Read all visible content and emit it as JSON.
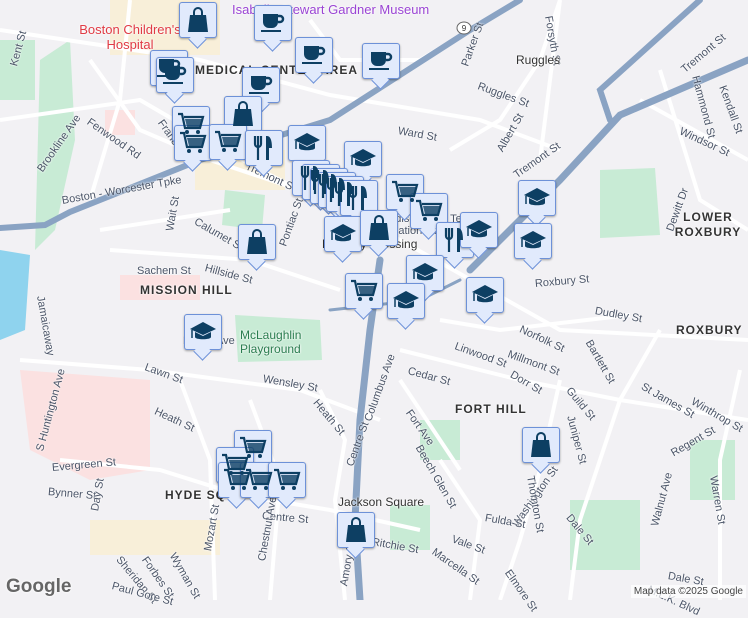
{
  "map": {
    "labels": [
      "Kent St",
      "Brookline Ave",
      "Fenwood Rd",
      "Boston - Worcester Tpke",
      "Wait St",
      "Calumet St",
      "Pontiac St",
      "Sachem St",
      "Hillside St",
      "Jamaicaway",
      "Parker St",
      "Ruggles St",
      "Forsyth St",
      "Ward St",
      "Albert St",
      "Tremont St",
      "Tremont St",
      "Hammond St",
      "Kendall St",
      "Windsor St",
      "Dewitt Dr",
      "Roxbury St",
      "Dudley St",
      "Norfolk St",
      "Bartlett St",
      "Millmont St",
      "Linwood St",
      "Dorr St",
      "Cedar St",
      "Columbus Ave",
      "Heath St",
      "Wensley St",
      "Lawn St",
      "Heath St",
      "Fisher Ave",
      "S Huntington Ave",
      "Evergreen St",
      "Bynner St",
      "Day St",
      "Centre St",
      "Centre St",
      "Fort Ave",
      "Beech Glen St",
      "Guild St",
      "St James St",
      "Juniper St",
      "Regent St",
      "Washington St",
      "Thornton St",
      "Dale St",
      "Walnut Ave",
      "Warren St",
      "Fulda St",
      "Vale St",
      "Marcella St",
      "Ritchie St",
      "Amory St",
      "Chestnut Ave",
      "Mozart St",
      "Wyman St",
      "Forbes St",
      "Sheridan St",
      "Paul Gore St",
      "M.L.K. Blvd",
      "Elmore St",
      "Dale St",
      "Tremont St",
      "Francis St",
      "Winthrop St"
    ],
    "areas": [
      "MISSION HILL",
      "LOWER ROXBURY",
      "ROXBURY",
      "FORT HILL",
      "HYDE SQ",
      "MEDICAL CENTER AREA"
    ],
    "pois": {
      "hospital": "Boston Children's Hospital",
      "museum": "Isabella Stewart Gardner Museum",
      "school": "Madison Park Technical Vocational High School",
      "park": "McLaughlin Playground"
    },
    "stations": [
      "Ruggles",
      "Roxbury Crossing",
      "Jackson Square"
    ],
    "route_shield": "9"
  },
  "markers": [
    {
      "type": "shopping-bag"
    },
    {
      "type": "coffee"
    },
    {
      "type": "coffee"
    },
    {
      "type": "coffee"
    },
    {
      "type": "coffee"
    },
    {
      "type": "coffee"
    },
    {
      "type": "coffee"
    },
    {
      "type": "shopping-bag"
    },
    {
      "type": "cart"
    },
    {
      "type": "cart"
    },
    {
      "type": "cart"
    },
    {
      "type": "restaurant"
    },
    {
      "type": "school"
    },
    {
      "type": "school"
    },
    {
      "type": "restaurant"
    },
    {
      "type": "restaurant"
    },
    {
      "type": "restaurant"
    },
    {
      "type": "restaurant"
    },
    {
      "type": "restaurant"
    },
    {
      "type": "restaurant"
    },
    {
      "type": "cart"
    },
    {
      "type": "cart"
    },
    {
      "type": "school"
    },
    {
      "type": "shopping-bag"
    },
    {
      "type": "restaurant"
    },
    {
      "type": "school"
    },
    {
      "type": "school"
    },
    {
      "type": "school"
    },
    {
      "type": "school"
    },
    {
      "type": "school"
    },
    {
      "type": "cart"
    },
    {
      "type": "school"
    },
    {
      "type": "school"
    },
    {
      "type": "shopping-bag"
    },
    {
      "type": "cart"
    },
    {
      "type": "cart"
    },
    {
      "type": "cart"
    },
    {
      "type": "cart"
    },
    {
      "type": "cart"
    },
    {
      "type": "shopping-bag"
    },
    {
      "type": "shopping-bag"
    }
  ],
  "footer": {
    "logo": "Google",
    "attribution": "Map data ©2025 Google"
  },
  "colors": {
    "marker_bg": "#e1eafc",
    "marker_border": "#6d91d8",
    "icon": "#0d3f63",
    "highway": "#8aa3c3",
    "park": "#c8ebd5",
    "water": "#8fd3ee"
  }
}
